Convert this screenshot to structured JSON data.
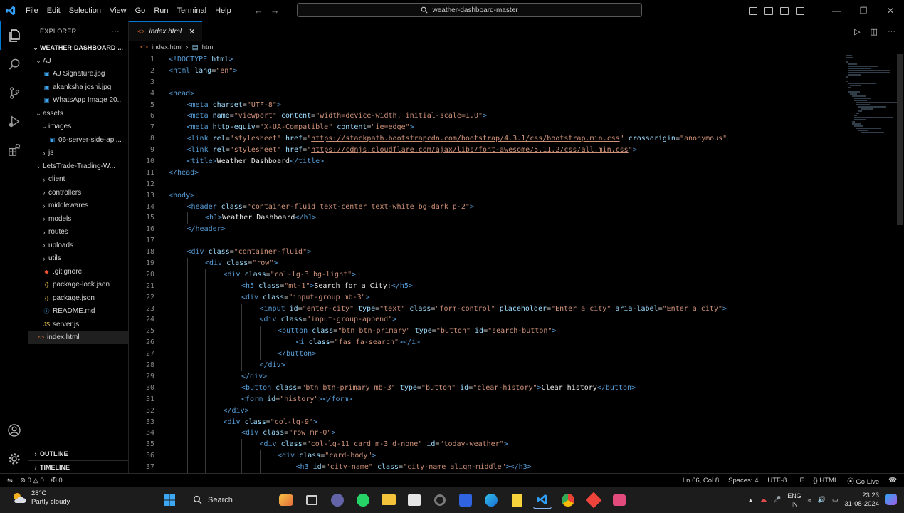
{
  "menu": [
    "File",
    "Edit",
    "Selection",
    "View",
    "Go",
    "Run",
    "Terminal",
    "Help"
  ],
  "command_center": "weather-dashboard-master",
  "explorer": {
    "title": "EXPLORER",
    "more": "···",
    "root": "WEATHER-DASHBOARD-...",
    "items": [
      {
        "label": "AJ",
        "depth": 0,
        "type": "folder-open"
      },
      {
        "label": "AJ Signature.jpg",
        "depth": 1,
        "type": "image"
      },
      {
        "label": "akanksha joshi.jpg",
        "depth": 1,
        "type": "image"
      },
      {
        "label": "WhatsApp Image 20...",
        "depth": 1,
        "type": "image"
      },
      {
        "label": "assets",
        "depth": 0,
        "type": "folder-open"
      },
      {
        "label": "images",
        "depth": 1,
        "type": "folder-open"
      },
      {
        "label": "06-server-side-api...",
        "depth": 2,
        "type": "image"
      },
      {
        "label": "js",
        "depth": 1,
        "type": "folder"
      },
      {
        "label": "LetsTrade-Trading-W...",
        "depth": 0,
        "type": "folder-open"
      },
      {
        "label": "client",
        "depth": 1,
        "type": "folder"
      },
      {
        "label": "controllers",
        "depth": 1,
        "type": "folder"
      },
      {
        "label": "middlewares",
        "depth": 1,
        "type": "folder"
      },
      {
        "label": "models",
        "depth": 1,
        "type": "folder"
      },
      {
        "label": "routes",
        "depth": 1,
        "type": "folder"
      },
      {
        "label": "uploads",
        "depth": 1,
        "type": "folder"
      },
      {
        "label": "utils",
        "depth": 1,
        "type": "folder"
      },
      {
        "label": ".gitignore",
        "depth": 1,
        "type": "git"
      },
      {
        "label": "package-lock.json",
        "depth": 1,
        "type": "json"
      },
      {
        "label": "package.json",
        "depth": 1,
        "type": "json"
      },
      {
        "label": "README.md",
        "depth": 1,
        "type": "md"
      },
      {
        "label": "server.js",
        "depth": 1,
        "type": "js"
      },
      {
        "label": "index.html",
        "depth": 0,
        "type": "html"
      }
    ],
    "outline": "OUTLINE",
    "timeline": "TIMELINE"
  },
  "editor": {
    "tab": "index.html",
    "breadcrumb": [
      "index.html",
      "html"
    ],
    "lines": [
      [
        [
          "t",
          "<!DOCTYPE "
        ],
        [
          "a",
          "html"
        ],
        [
          "t",
          ">"
        ]
      ],
      [
        [
          "t",
          "<html "
        ],
        [
          "a",
          "lang"
        ],
        [
          "p",
          "="
        ],
        [
          "s",
          "\"en\""
        ],
        [
          "t",
          ">"
        ]
      ],
      [],
      [
        [
          "t",
          "<head>"
        ]
      ],
      [
        [
          "i",
          1
        ],
        [
          "t",
          "<meta "
        ],
        [
          "a",
          "charset"
        ],
        [
          "p",
          "="
        ],
        [
          "s",
          "\"UTF-8\""
        ],
        [
          "t",
          ">"
        ]
      ],
      [
        [
          "i",
          1
        ],
        [
          "t",
          "<meta "
        ],
        [
          "a",
          "name"
        ],
        [
          "p",
          "="
        ],
        [
          "s",
          "\"viewport\""
        ],
        [
          "p",
          " "
        ],
        [
          "a",
          "content"
        ],
        [
          "p",
          "="
        ],
        [
          "s",
          "\"width=device-width, initial-scale=1.0\""
        ],
        [
          "t",
          ">"
        ]
      ],
      [
        [
          "i",
          1
        ],
        [
          "t",
          "<meta "
        ],
        [
          "a",
          "http-equiv"
        ],
        [
          "p",
          "="
        ],
        [
          "s",
          "\"X-UA-Compatible\""
        ],
        [
          "p",
          " "
        ],
        [
          "a",
          "content"
        ],
        [
          "p",
          "="
        ],
        [
          "s",
          "\"ie=edge\""
        ],
        [
          "t",
          ">"
        ]
      ],
      [
        [
          "i",
          1
        ],
        [
          "t",
          "<link "
        ],
        [
          "a",
          "rel"
        ],
        [
          "p",
          "="
        ],
        [
          "s",
          "\"stylesheet\""
        ],
        [
          "p",
          " "
        ],
        [
          "a",
          "href"
        ],
        [
          "p",
          "="
        ],
        [
          "s",
          "\""
        ],
        [
          "u",
          "https://stackpath.bootstrapcdn.com/bootstrap/4.3.1/css/bootstrap.min.css"
        ],
        [
          "s",
          "\""
        ],
        [
          "p",
          " "
        ],
        [
          "a",
          "crossorigin"
        ],
        [
          "p",
          "="
        ],
        [
          "s",
          "\"anonymous\""
        ]
      ],
      [
        [
          "i",
          1
        ],
        [
          "t",
          "<link "
        ],
        [
          "a",
          "rel"
        ],
        [
          "p",
          "="
        ],
        [
          "s",
          "\"stylesheet\""
        ],
        [
          "p",
          " "
        ],
        [
          "a",
          "href"
        ],
        [
          "p",
          "="
        ],
        [
          "s",
          "\""
        ],
        [
          "u",
          "https://cdnjs.cloudflare.com/ajax/libs/font-awesome/5.11.2/css/all.min.css"
        ],
        [
          "s",
          "\""
        ],
        [
          "t",
          ">"
        ]
      ],
      [
        [
          "i",
          1
        ],
        [
          "t",
          "<title>"
        ],
        [
          "x",
          "Weather Dashboard"
        ],
        [
          "t",
          "</title>"
        ]
      ],
      [
        [
          "t",
          "</head>"
        ]
      ],
      [],
      [
        [
          "t",
          "<body>"
        ]
      ],
      [
        [
          "i",
          1
        ],
        [
          "t",
          "<header "
        ],
        [
          "a",
          "class"
        ],
        [
          "p",
          "="
        ],
        [
          "s",
          "\"container-fluid text-center text-white bg-dark p-2\""
        ],
        [
          "t",
          ">"
        ]
      ],
      [
        [
          "i",
          2
        ],
        [
          "t",
          "<h1>"
        ],
        [
          "x",
          "Weather Dashboard"
        ],
        [
          "t",
          "</h1>"
        ]
      ],
      [
        [
          "i",
          1
        ],
        [
          "t",
          "</header>"
        ]
      ],
      [],
      [
        [
          "i",
          1
        ],
        [
          "t",
          "<div "
        ],
        [
          "a",
          "class"
        ],
        [
          "p",
          "="
        ],
        [
          "s",
          "\"container-fluid\""
        ],
        [
          "t",
          ">"
        ]
      ],
      [
        [
          "i",
          2
        ],
        [
          "t",
          "<div "
        ],
        [
          "a",
          "class"
        ],
        [
          "p",
          "="
        ],
        [
          "s",
          "\"row\""
        ],
        [
          "t",
          ">"
        ]
      ],
      [
        [
          "i",
          3
        ],
        [
          "t",
          "<div "
        ],
        [
          "a",
          "class"
        ],
        [
          "p",
          "="
        ],
        [
          "s",
          "\"col-lg-3 bg-light\""
        ],
        [
          "t",
          ">"
        ]
      ],
      [
        [
          "i",
          4
        ],
        [
          "t",
          "<h5 "
        ],
        [
          "a",
          "class"
        ],
        [
          "p",
          "="
        ],
        [
          "s",
          "\"mt-1\""
        ],
        [
          "t",
          ">"
        ],
        [
          "x",
          "Search for a City:"
        ],
        [
          "t",
          "</h5>"
        ]
      ],
      [
        [
          "i",
          4
        ],
        [
          "t",
          "<div "
        ],
        [
          "a",
          "class"
        ],
        [
          "p",
          "="
        ],
        [
          "s",
          "\"input-group mb-3\""
        ],
        [
          "t",
          ">"
        ]
      ],
      [
        [
          "i",
          5
        ],
        [
          "t",
          "<input "
        ],
        [
          "a",
          "id"
        ],
        [
          "p",
          "="
        ],
        [
          "s",
          "\"enter-city\""
        ],
        [
          "p",
          " "
        ],
        [
          "a",
          "type"
        ],
        [
          "p",
          "="
        ],
        [
          "s",
          "\"text\""
        ],
        [
          "p",
          " "
        ],
        [
          "a",
          "class"
        ],
        [
          "p",
          "="
        ],
        [
          "s",
          "\"form-control\""
        ],
        [
          "p",
          " "
        ],
        [
          "a",
          "placeholder"
        ],
        [
          "p",
          "="
        ],
        [
          "s",
          "\"Enter a city\""
        ],
        [
          "p",
          " "
        ],
        [
          "a",
          "aria-label"
        ],
        [
          "p",
          "="
        ],
        [
          "s",
          "\"Enter a city\""
        ],
        [
          "t",
          ">"
        ]
      ],
      [
        [
          "i",
          5
        ],
        [
          "t",
          "<div "
        ],
        [
          "a",
          "class"
        ],
        [
          "p",
          "="
        ],
        [
          "s",
          "\"input-group-append\""
        ],
        [
          "t",
          ">"
        ]
      ],
      [
        [
          "i",
          6
        ],
        [
          "t",
          "<button "
        ],
        [
          "a",
          "class"
        ],
        [
          "p",
          "="
        ],
        [
          "s",
          "\"btn btn-primary\""
        ],
        [
          "p",
          " "
        ],
        [
          "a",
          "type"
        ],
        [
          "p",
          "="
        ],
        [
          "s",
          "\"button\""
        ],
        [
          "p",
          " "
        ],
        [
          "a",
          "id"
        ],
        [
          "p",
          "="
        ],
        [
          "s",
          "\"search-button\""
        ],
        [
          "t",
          ">"
        ]
      ],
      [
        [
          "i",
          7
        ],
        [
          "t",
          "<i "
        ],
        [
          "a",
          "class"
        ],
        [
          "p",
          "="
        ],
        [
          "s",
          "\"fas fa-search\""
        ],
        [
          "t",
          "></i>"
        ]
      ],
      [
        [
          "i",
          6
        ],
        [
          "t",
          "</button>"
        ]
      ],
      [
        [
          "i",
          5
        ],
        [
          "t",
          "</div>"
        ]
      ],
      [
        [
          "i",
          4
        ],
        [
          "t",
          "</div>"
        ]
      ],
      [
        [
          "i",
          4
        ],
        [
          "t",
          "<button "
        ],
        [
          "a",
          "class"
        ],
        [
          "p",
          "="
        ],
        [
          "s",
          "\"btn btn-primary mb-3\""
        ],
        [
          "p",
          " "
        ],
        [
          "a",
          "type"
        ],
        [
          "p",
          "="
        ],
        [
          "s",
          "\"button\""
        ],
        [
          "p",
          " "
        ],
        [
          "a",
          "id"
        ],
        [
          "p",
          "="
        ],
        [
          "s",
          "\"clear-history\""
        ],
        [
          "t",
          ">"
        ],
        [
          "x",
          "Clear history"
        ],
        [
          "t",
          "</button>"
        ]
      ],
      [
        [
          "i",
          4
        ],
        [
          "t",
          "<form "
        ],
        [
          "a",
          "id"
        ],
        [
          "p",
          "="
        ],
        [
          "s",
          "\"history\""
        ],
        [
          "t",
          "></form>"
        ]
      ],
      [
        [
          "i",
          3
        ],
        [
          "t",
          "</div>"
        ]
      ],
      [
        [
          "i",
          3
        ],
        [
          "t",
          "<div "
        ],
        [
          "a",
          "class"
        ],
        [
          "p",
          "="
        ],
        [
          "s",
          "\"col-lg-9\""
        ],
        [
          "t",
          ">"
        ]
      ],
      [
        [
          "i",
          4
        ],
        [
          "t",
          "<div "
        ],
        [
          "a",
          "class"
        ],
        [
          "p",
          "="
        ],
        [
          "s",
          "\"row mr-0\""
        ],
        [
          "t",
          ">"
        ]
      ],
      [
        [
          "i",
          5
        ],
        [
          "t",
          "<div "
        ],
        [
          "a",
          "class"
        ],
        [
          "p",
          "="
        ],
        [
          "s",
          "\"col-lg-11 card m-3 d-none\""
        ],
        [
          "p",
          " "
        ],
        [
          "a",
          "id"
        ],
        [
          "p",
          "="
        ],
        [
          "s",
          "\"today-weather\""
        ],
        [
          "t",
          ">"
        ]
      ],
      [
        [
          "i",
          6
        ],
        [
          "t",
          "<div "
        ],
        [
          "a",
          "class"
        ],
        [
          "p",
          "="
        ],
        [
          "s",
          "\"card-body\""
        ],
        [
          "t",
          ">"
        ]
      ],
      [
        [
          "i",
          7
        ],
        [
          "t",
          "<h3 "
        ],
        [
          "a",
          "id"
        ],
        [
          "p",
          "="
        ],
        [
          "s",
          "\"city-name\""
        ],
        [
          "p",
          " "
        ],
        [
          "a",
          "class"
        ],
        [
          "p",
          "="
        ],
        [
          "s",
          "\"city-name align-middle\""
        ],
        [
          "t",
          "></h3>"
        ]
      ]
    ]
  },
  "status": {
    "errors": "0",
    "warnings": "0",
    "ports": "0",
    "position": "Ln 66, Col 8",
    "spaces": "Spaces: 4",
    "encoding": "UTF-8",
    "eol": "LF",
    "language": "HTML",
    "golive": "Go Live"
  },
  "taskbar": {
    "temp": "28°C",
    "condition": "Partly cloudy",
    "search": "Search",
    "lang_top": "ENG",
    "lang_bottom": "IN",
    "time": "23:23",
    "date": "31-08-2024"
  },
  "colors": {
    "accent": "#0078d4",
    "tag": "#569cd6",
    "attr": "#9cdcfe",
    "string": "#ce9178"
  }
}
